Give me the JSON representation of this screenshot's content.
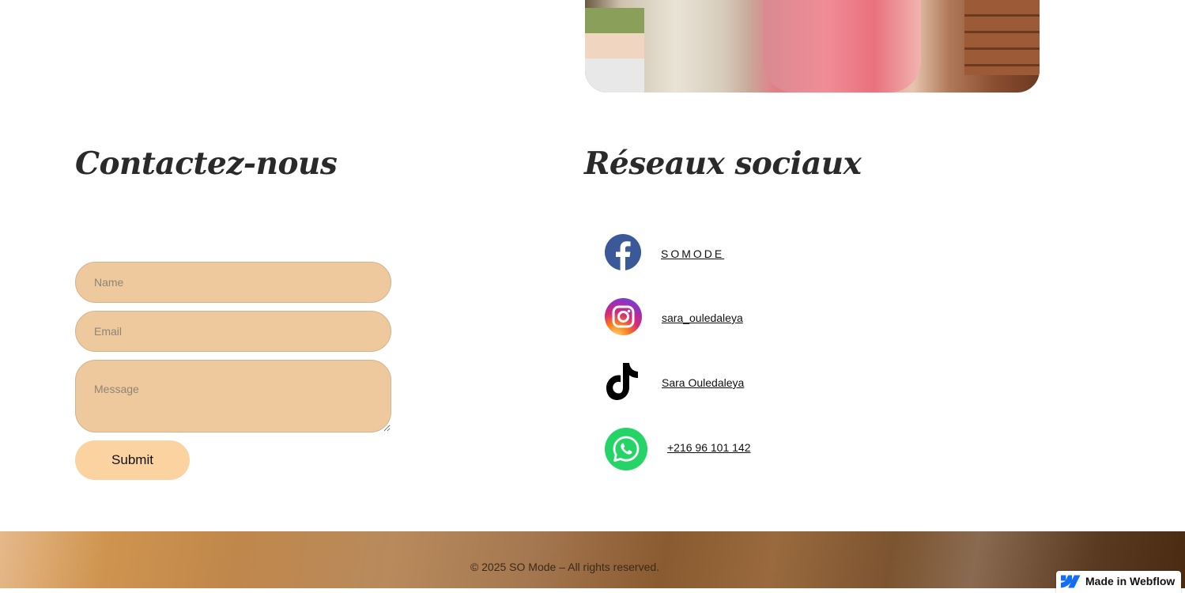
{
  "contact": {
    "heading": "Contactez-nous",
    "name_placeholder": "Name",
    "email_placeholder": "Email",
    "message_placeholder": "Message",
    "submit_label": "Submit"
  },
  "social": {
    "heading": "Réseaux sociaux",
    "items": [
      {
        "icon": "facebook-icon",
        "label": "SOMODE",
        "color": "#3b5998"
      },
      {
        "icon": "instagram-icon",
        "label": "sara_ouledaleya",
        "color": "#d62976"
      },
      {
        "icon": "tiktok-icon",
        "label": "Sara Ouledaleya",
        "color": "#000000"
      },
      {
        "icon": "whatsapp-icon",
        "label": "+216 96 101 142",
        "color": "#25d366"
      }
    ]
  },
  "footer": {
    "copyright": "© 2025 SO Mode – All rights reserved."
  },
  "badge": {
    "label": "Made in Webflow",
    "color": "#146ef5"
  },
  "colors": {
    "field_bg": "#edc99d",
    "button_bg": "#fbd3a0"
  }
}
